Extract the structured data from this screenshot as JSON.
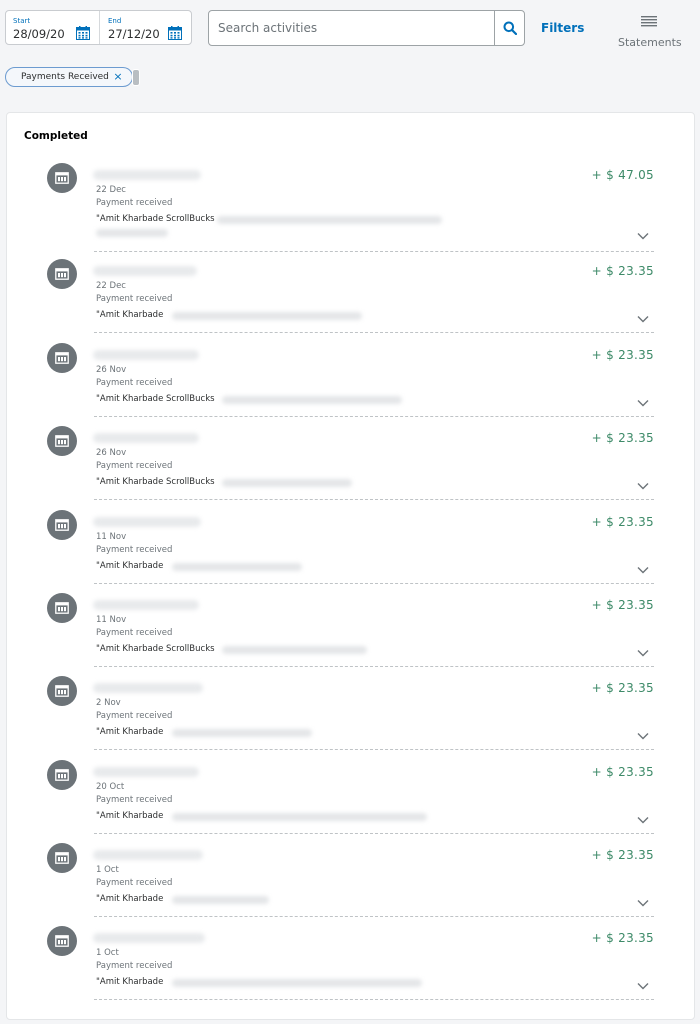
{
  "filters": {
    "start_label": "Start",
    "start_value": "28/09/20",
    "end_label": "End",
    "end_value": "27/12/20",
    "search_placeholder": "Search activities",
    "filters_label": "Filters",
    "statements_label": "Statements"
  },
  "chip": {
    "label": "Payments Received",
    "close_symbol": "×"
  },
  "section_title": "Completed",
  "colors": {
    "brand_blue": "#0070ba",
    "amount_green": "#3d8a68",
    "avatar_gray": "#6c7378"
  },
  "transactions": [
    {
      "date": "22 Dec",
      "type": "Payment received",
      "note": "\"Amit Kharbade ScrollBucks",
      "amount": "+ $ 47.05"
    },
    {
      "date": "22 Dec",
      "type": "Payment received",
      "note": "\"Amit Kharbade",
      "amount": "+ $ 23.35"
    },
    {
      "date": "26 Nov",
      "type": "Payment received",
      "note": "\"Amit Kharbade ScrollBucks",
      "amount": "+ $ 23.35"
    },
    {
      "date": "26 Nov",
      "type": "Payment received",
      "note": "\"Amit Kharbade ScrollBucks",
      "amount": "+ $ 23.35"
    },
    {
      "date": "11 Nov",
      "type": "Payment received",
      "note": "\"Amit Kharbade",
      "amount": "+ $ 23.35"
    },
    {
      "date": "11 Nov",
      "type": "Payment received",
      "note": "\"Amit Kharbade ScrollBucks",
      "amount": "+ $ 23.35"
    },
    {
      "date": "2 Nov",
      "type": "Payment received",
      "note": "\"Amit Kharbade",
      "amount": "+ $ 23.35"
    },
    {
      "date": "20 Oct",
      "type": "Payment received",
      "note": "\"Amit Kharbade",
      "amount": "+ $ 23.35"
    },
    {
      "date": "1 Oct",
      "type": "Payment received",
      "note": "\"Amit Kharbade",
      "amount": "+ $ 23.35"
    },
    {
      "date": "1 Oct",
      "type": "Payment received",
      "note": "\"Amit Kharbade",
      "amount": "+ $ 23.35"
    }
  ]
}
